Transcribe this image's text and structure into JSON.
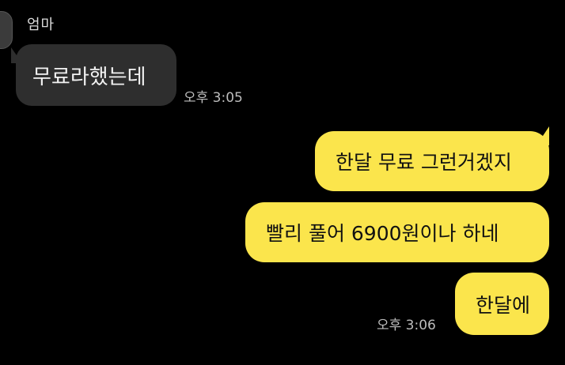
{
  "chat": {
    "sender_name": "엄마",
    "messages": [
      {
        "direction": "in",
        "text": "무료라했는데",
        "time": "오후 3:05"
      },
      {
        "direction": "out",
        "text": "한달 무료 그런거겠지"
      },
      {
        "direction": "out",
        "text": "빨리 풀어 6900원이나 하네"
      },
      {
        "direction": "out",
        "text": "한달에",
        "time": "오후 3:06"
      }
    ]
  },
  "colors": {
    "background": "#000000",
    "incoming_bubble": "#2e2e2e",
    "outgoing_bubble": "#fbe54c",
    "timestamp": "#bdbdbd"
  }
}
